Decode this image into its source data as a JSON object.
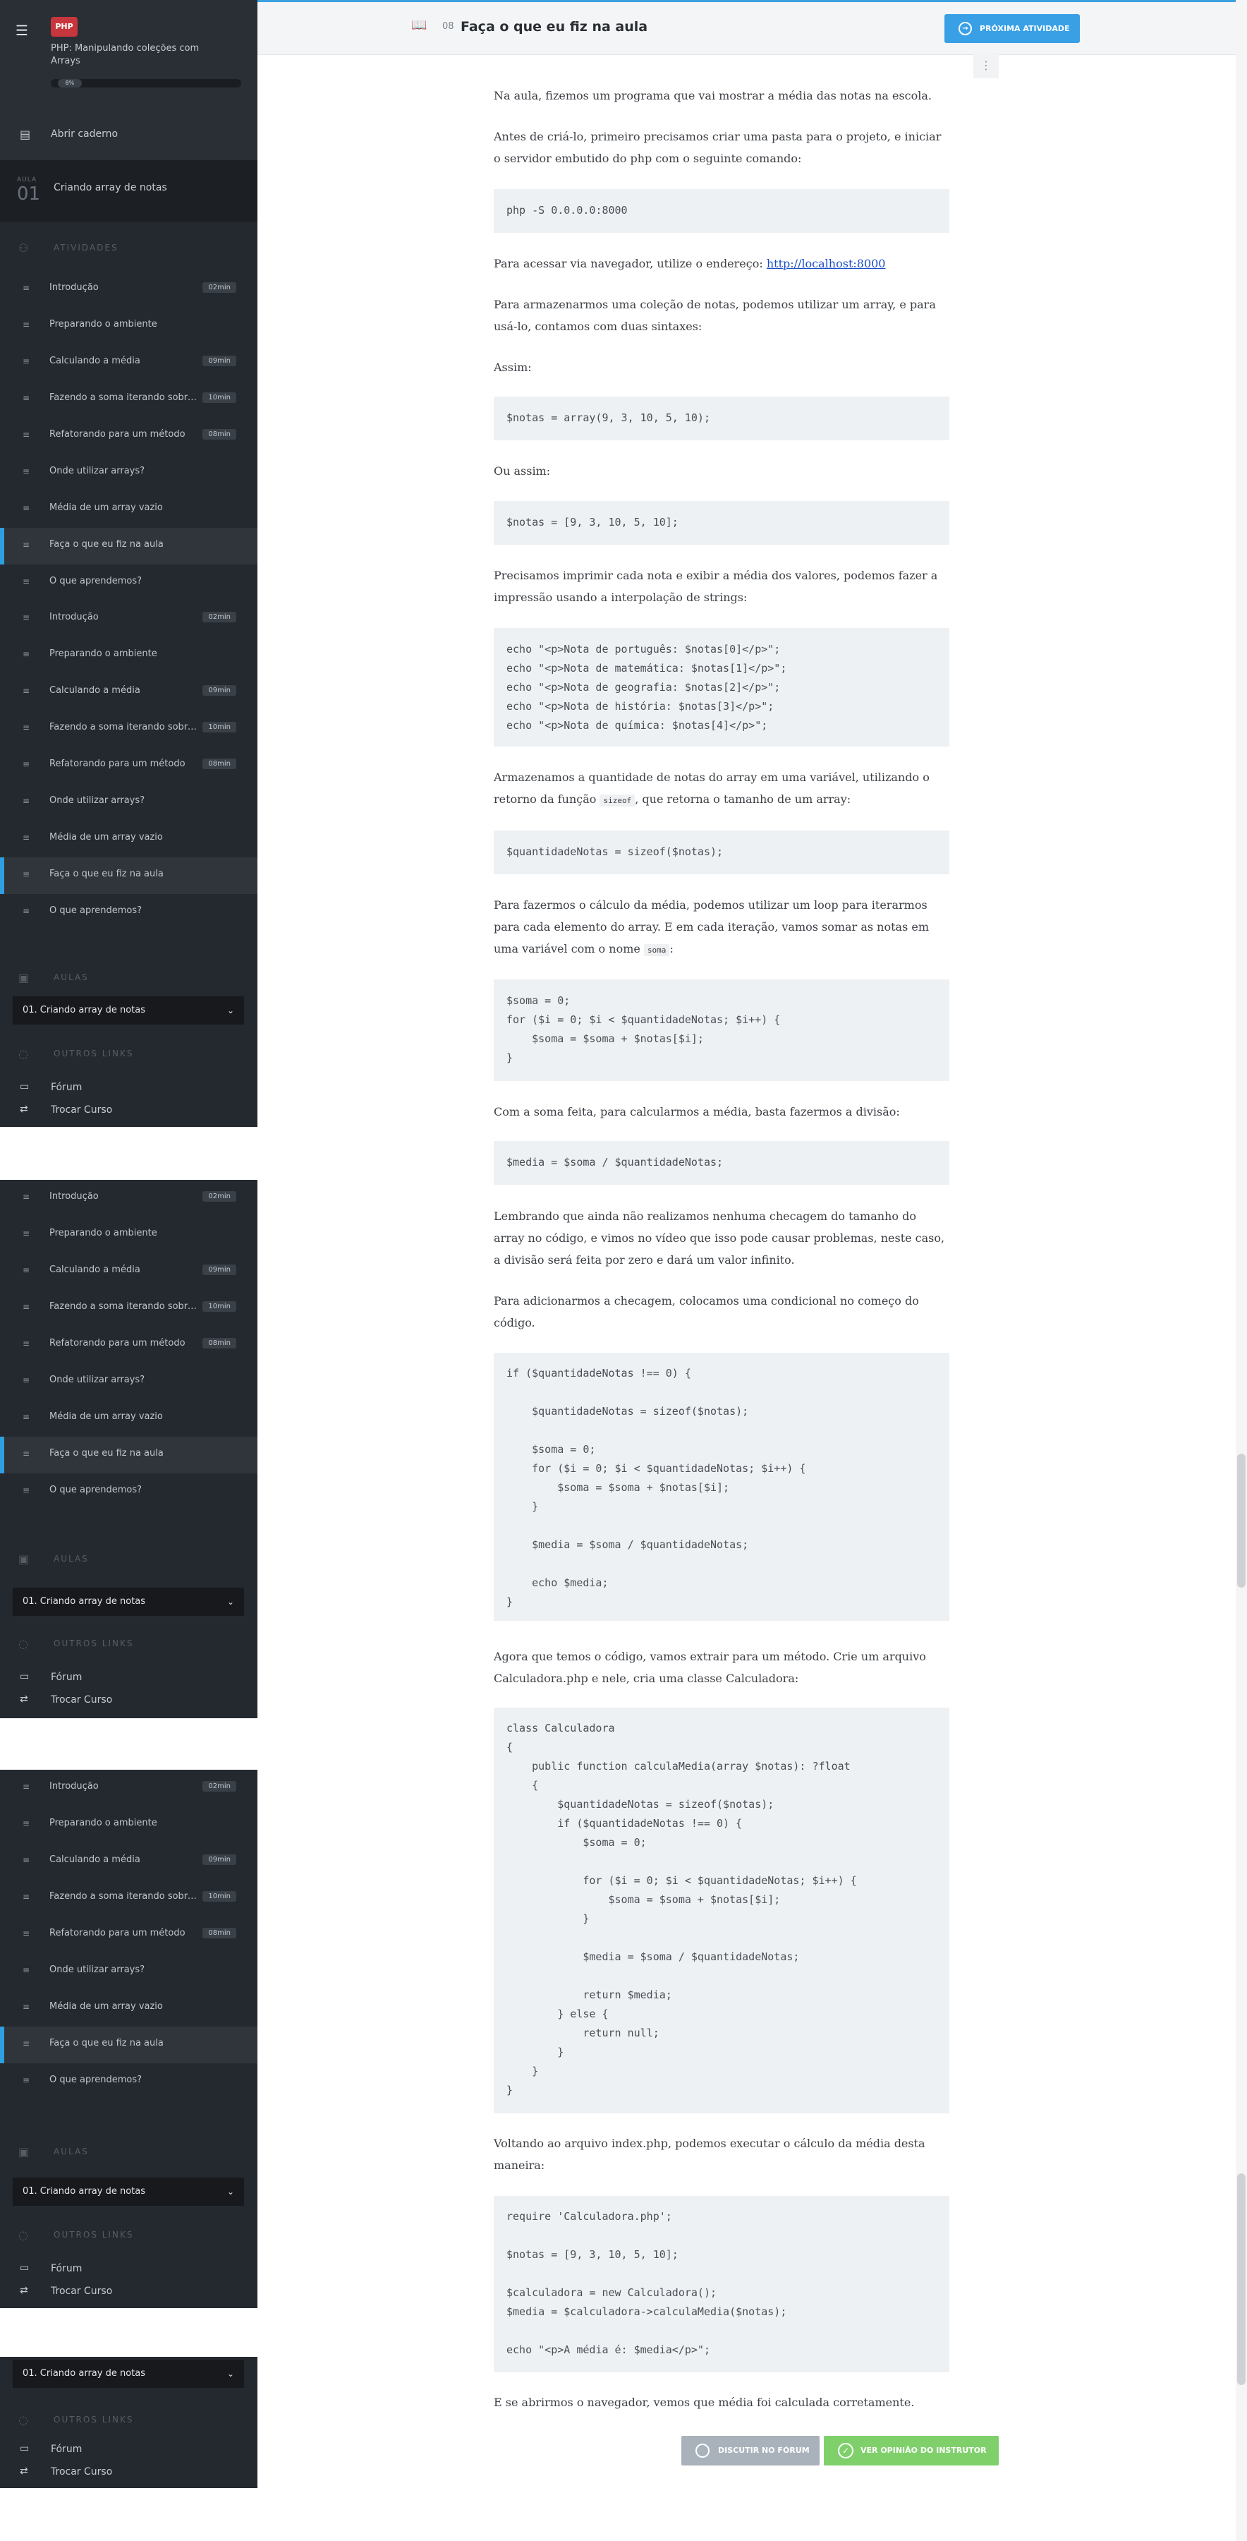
{
  "header": {
    "menu_icon": "menu-icon",
    "logo_text": "PHP",
    "course_title": "PHP: Manipulando coleções com Arrays",
    "progress_pct": 8,
    "notebook_label": "Abrir caderno",
    "aula_label": "AULA",
    "aula_number": "01",
    "aula_title": "Criando array de notas"
  },
  "sidebar": {
    "activities_label": "ATIVIDADES",
    "aulas_label": "AULAS",
    "other_links_label": "OUTROS LINKS",
    "aula_select": "01. Criando array de notas",
    "links": {
      "forum": "Fórum",
      "switch_course": "Trocar Curso"
    },
    "items": [
      {
        "label": "Introdução",
        "duration": "02min",
        "icon": "video-icon"
      },
      {
        "label": "Preparando o ambiente",
        "duration": "",
        "icon": "text-icon"
      },
      {
        "label": "Calculando a média",
        "duration": "09min",
        "icon": "video-icon"
      },
      {
        "label": "Fazendo a soma iterando sobre o array",
        "duration": "10min",
        "icon": "video-icon"
      },
      {
        "label": "Refatorando para um método",
        "duration": "08min",
        "icon": "video-icon"
      },
      {
        "label": "Onde utilizar arrays?",
        "duration": "",
        "icon": "list-icon"
      },
      {
        "label": "Média de um array vazio",
        "duration": "",
        "icon": "text-icon"
      },
      {
        "label": "Faça o que eu fiz na aula",
        "duration": "",
        "icon": "book-icon"
      },
      {
        "label": "O que aprendemos?",
        "duration": "",
        "icon": "text-icon"
      }
    ]
  },
  "topbar": {
    "activity_number": "08",
    "activity_title": "Faça o que eu fiz na aula",
    "next_button": "PRÓXIMA ATIVIDADE"
  },
  "content": {
    "p1": "Na aula, fizemos um programa que vai mostrar a média das notas na escola.",
    "p2": "Antes de criá-lo, primeiro precisamos criar uma pasta para o projeto, e iniciar o servidor embutido do php com o seguinte comando:",
    "p3_prefix": "Para acessar via navegador, utilize o endereço: ",
    "p3_link": "http://localhost:8000",
    "p4": "Para armazenarmos uma coleção de notas, podemos utilizar um array, e para usá-lo, contamos com duas sintaxes:",
    "p5": "Assim:",
    "p6": "Ou assim:",
    "p7": "Precisamos imprimir cada nota e exibir a média dos valores, podemos fazer a impressão usando a interpolação de strings:",
    "p8_a": "Armazenamos a quantidade de notas do array em uma variável, utilizando o retorno da função ",
    "p8_code": "sizeof",
    "p8_b": ", que retorna o tamanho de um array:",
    "p9_a": "Para fazermos o cálculo da média, podemos utilizar um loop para iterarmos para cada elemento do array. E em cada iteração, vamos somar as notas em uma variável com o nome ",
    "p9_code": "soma",
    "p9_b": ":",
    "p10": "Com a soma feita, para calcularmos a média, basta fazermos a divisão:",
    "p11": "Lembrando que ainda não realizamos nenhuma checagem do tamanho do array no código, e vimos no vídeo que isso pode causar problemas, neste caso, a divisão será feita por zero e dará um valor infinito.",
    "p12": "Para adicionarmos a checagem, colocamos uma condicional no começo do código.",
    "p13": "Agora que temos o código, vamos extrair para um método. Crie um arquivo Calculadora.php e nele, cria uma classe Calculadora:",
    "p14": "Voltando ao arquivo index.php, podemos executar o cálculo da média desta maneira:",
    "p15": "E se abrirmos o navegador, vemos que média foi calculada corretamente."
  },
  "code": {
    "c1": [
      "php -S 0.0.0.0:8000"
    ],
    "c2": [
      "$notas = array(9, 3, 10, 5, 10);"
    ],
    "c3": [
      "$notas = [9, 3, 10, 5, 10];"
    ],
    "c4": [
      "echo \"<p>Nota de português: $notas[0]</p>\";",
      "echo \"<p>Nota de matemática: $notas[1]</p>\";",
      "echo \"<p>Nota de geografia: $notas[2]</p>\";",
      "echo \"<p>Nota de história: $notas[3]</p>\";",
      "echo \"<p>Nota de química: $notas[4]</p>\";"
    ],
    "c5": [
      "$quantidadeNotas = sizeof($notas);"
    ],
    "c6": [
      "$soma = 0;",
      "for ($i = 0; $i < $quantidadeNotas; $i++) {",
      "    $soma = $soma + $notas[$i];",
      "}"
    ],
    "c7": [
      "$media = $soma / $quantidadeNotas;"
    ],
    "c8": [
      "if ($quantidadeNotas !== 0) {",
      "",
      "    $quantidadeNotas = sizeof($notas);",
      "",
      "    $soma = 0;",
      "    for ($i = 0; $i < $quantidadeNotas; $i++) {",
      "        $soma = $soma + $notas[$i];",
      "    }",
      "",
      "    $media = $soma / $quantidadeNotas;",
      "",
      "    echo $media;",
      "}"
    ],
    "c9": [
      "class Calculadora",
      "{",
      "    public function calculaMedia(array $notas): ?float",
      "    {",
      "        $quantidadeNotas = sizeof($notas);",
      "        if ($quantidadeNotas !== 0) {",
      "            $soma = 0;",
      "",
      "            for ($i = 0; $i < $quantidadeNotas; $i++) {",
      "                $soma = $soma + $notas[$i];",
      "            }",
      "",
      "            $media = $soma / $quantidadeNotas;",
      "",
      "            return $media;",
      "        } else {",
      "            return null;",
      "        }",
      "    }",
      "}"
    ],
    "c10": [
      "require 'Calculadora.php';",
      "",
      "$notas = [9, 3, 10, 5, 10];",
      "",
      "$calculadora = new Calculadora();",
      "$media = $calculadora->calculaMedia($notas);",
      "",
      "echo \"<p>A média é: $media</p>\";"
    ]
  },
  "buttons": {
    "forum": "DISCUTIR NO FÓRUM",
    "opinion": "VER OPINIÃO DO INSTRUTOR"
  },
  "colors": {
    "accent": "#39a0e6",
    "sidebar": "#24292f",
    "success": "#7fd06b"
  }
}
